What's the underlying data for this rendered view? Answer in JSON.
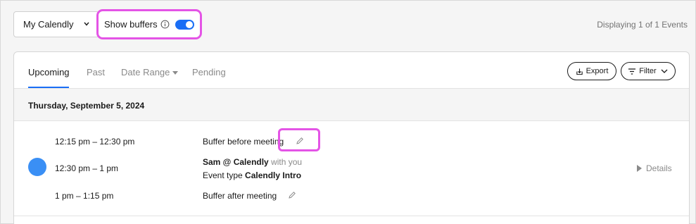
{
  "toolbar": {
    "calendar_select": "My Calendly",
    "show_buffers_label": "Show buffers",
    "show_buffers_on": true,
    "displaying": "Displaying 1 of 1 Events"
  },
  "tabs": [
    {
      "label": "Upcoming",
      "active": true
    },
    {
      "label": "Past",
      "active": false
    },
    {
      "label": "Date Range",
      "active": false
    },
    {
      "label": "Pending",
      "active": false
    }
  ],
  "actions": {
    "export_label": "Export",
    "filter_label": "Filter"
  },
  "date_header": "Thursday, September 5, 2024",
  "events": {
    "buffer_before": {
      "time": "12:15 pm – 12:30 pm",
      "label": "Buffer before meeting"
    },
    "meeting": {
      "time": "12:30 pm – 1 pm",
      "title": "Sam @ Calendly",
      "with": " with you",
      "event_type_prefix": "Event type ",
      "event_type": "Calendly Intro",
      "details_label": "Details",
      "dot_color": "#3a8ff5"
    },
    "buffer_after": {
      "time": "1 pm – 1:15 pm",
      "label": "Buffer after meeting"
    }
  },
  "colors": {
    "accent": "#1a6ef5",
    "highlight": "#e454e6"
  }
}
